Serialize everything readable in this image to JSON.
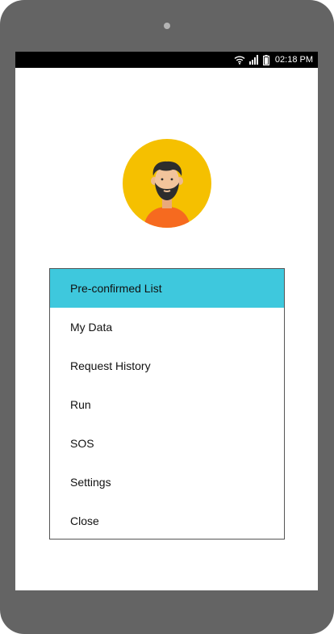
{
  "status_bar": {
    "time": "02:18 PM",
    "icons": [
      "wifi-icon",
      "signal-icon",
      "battery-icon"
    ]
  },
  "profile": {
    "avatar_icon": "user-avatar-bearded-man",
    "background_color": "#f5c000"
  },
  "menu": {
    "active_index": 0,
    "active_color": "#3ec8dd",
    "items": [
      {
        "label": "Pre-confirmed List"
      },
      {
        "label": "My Data"
      },
      {
        "label": "Request History"
      },
      {
        "label": "Run"
      },
      {
        "label": "SOS"
      },
      {
        "label": "Settings"
      },
      {
        "label": "Close"
      }
    ]
  }
}
